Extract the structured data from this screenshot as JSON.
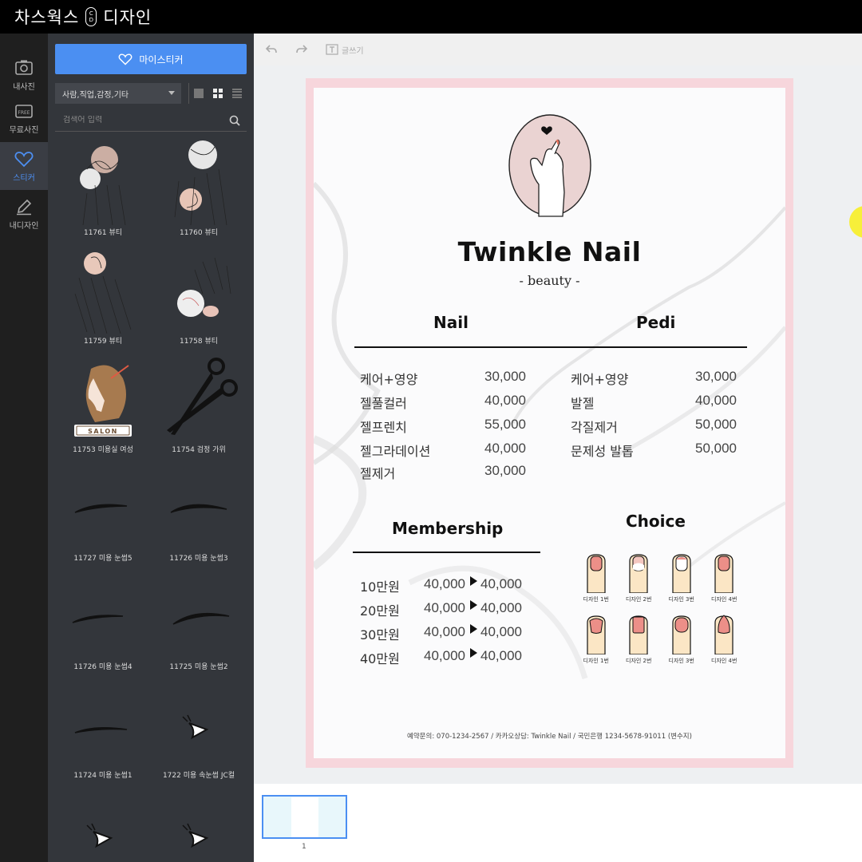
{
  "app": {
    "brand_left": "차스웍스",
    "logo_top": "C",
    "logo_bottom": "D",
    "brand_right": "디자인"
  },
  "nav": [
    {
      "label": "내사진",
      "icon": "camera-icon"
    },
    {
      "label": "무료사진",
      "icon": "free-photo-icon",
      "badge": "FREE"
    },
    {
      "label": "스티커",
      "icon": "heart-icon",
      "active": true
    },
    {
      "label": "내디자인",
      "icon": "pencil-icon"
    }
  ],
  "panel": {
    "my_sticker_label": "마이스티커",
    "category_value": "사람,직업,감정,기타",
    "search_placeholder": "검색어 입력",
    "stickers": [
      {
        "caption": "11761 뷰티"
      },
      {
        "caption": "11760 뷰티"
      },
      {
        "caption": "11759 뷰티"
      },
      {
        "caption": "11758 뷰티"
      },
      {
        "caption": "11753 미용실 여성",
        "badge": "SALON"
      },
      {
        "caption": "11754 검정 가위"
      },
      {
        "caption": "11727 미용 눈썹5"
      },
      {
        "caption": "11726 미용 눈썹3"
      },
      {
        "caption": "11726 미용 눈썹4"
      },
      {
        "caption": "11725 미용 눈썹2"
      },
      {
        "caption": "11724 미용 눈썹1"
      },
      {
        "caption": "1722 미용 속눈썹 JC컬"
      }
    ]
  },
  "toolbar": {
    "undo": "undo-icon",
    "redo": "redo-icon",
    "text_label": "글쓰기"
  },
  "flyer": {
    "title": "Twinkle Nail",
    "subtitle": "- beauty -",
    "nail_header": "Nail",
    "pedi_header": "Pedi",
    "nail_prices": [
      {
        "item": "케어+영양",
        "price": "30,000"
      },
      {
        "item": "젤풀컬러",
        "price": "40,000"
      },
      {
        "item": "젤프렌치",
        "price": "55,000"
      },
      {
        "item": "젤그라데이션",
        "price": "40,000"
      },
      {
        "item": "젤제거",
        "price": "30,000"
      }
    ],
    "pedi_prices": [
      {
        "item": "케어+영양",
        "price": "30,000"
      },
      {
        "item": "발젤",
        "price": "40,000"
      },
      {
        "item": "각질제거",
        "price": "50,000"
      },
      {
        "item": "문제성 발톱",
        "price": "50,000"
      }
    ],
    "membership_header": "Membership",
    "membership": [
      {
        "tier": "10만원",
        "from": "40,000",
        "to": "40,000"
      },
      {
        "tier": "20만원",
        "from": "40,000",
        "to": "40,000"
      },
      {
        "tier": "30만원",
        "from": "40,000",
        "to": "40,000"
      },
      {
        "tier": "40만원",
        "from": "40,000",
        "to": "40,000"
      }
    ],
    "choice_header": "Choice",
    "designs_row1": [
      "디자인 1번",
      "디자인 2번",
      "디자인 3번",
      "디자인 4번"
    ],
    "designs_row2": [
      "디자인 1번",
      "디자인 2번",
      "디자인 3번",
      "디자인 4번"
    ],
    "footer": "예약문의: 070-1234-2567 / 카카오상담: Twinkle Nail / 국민은행 1234-5678-91011 (변수지)"
  },
  "pages": {
    "current": "1"
  },
  "colors": {
    "accent": "#4b8ff2",
    "page_border": "#f7d6dc",
    "nail_pink": "#ec8f88",
    "skin": "#fbe6c5"
  }
}
